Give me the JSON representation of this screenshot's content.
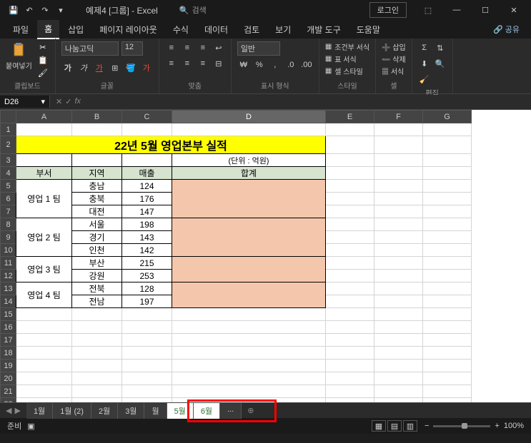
{
  "title": "예제4 [그룹] - Excel",
  "search_placeholder": "검색",
  "login_label": "로그인",
  "tabs": {
    "file": "파일",
    "home": "홈",
    "insert": "삽입",
    "layout": "페이지 레이아웃",
    "formula": "수식",
    "data": "데이터",
    "review": "검토",
    "view": "보기",
    "dev": "개발 도구",
    "help": "도움말"
  },
  "share_label": "공유",
  "ribbon": {
    "clipboard": {
      "label": "클립보드",
      "paste": "붙여넣기"
    },
    "font": {
      "label": "글꼴",
      "name": "나눔고딕",
      "size": "12",
      "bold": "가",
      "italic": "가",
      "underline": "가"
    },
    "align": {
      "label": "맞춤"
    },
    "number": {
      "label": "표시 형식",
      "format": "일반"
    },
    "styles": {
      "label": "스타일",
      "cond": "조건부 서식",
      "table": "표 서식",
      "cell": "셀 스타일"
    },
    "cells": {
      "label": "셀",
      "insert": "삽입",
      "delete": "삭제",
      "format": "서식"
    },
    "edit": {
      "label": "편집"
    }
  },
  "namebox": "D26",
  "chart_data": {
    "type": "table",
    "title": "22년 5월 영업본부 실적",
    "unit": "(단위 : 억원)",
    "columns": [
      "부서",
      "지역",
      "매출",
      "합계"
    ],
    "rows": [
      {
        "dept": "영업 1 팀",
        "region": "충남",
        "sales": 124
      },
      {
        "dept": "",
        "region": "충북",
        "sales": 176
      },
      {
        "dept": "",
        "region": "대전",
        "sales": 147
      },
      {
        "dept": "영업 2 팀",
        "region": "서울",
        "sales": 198
      },
      {
        "dept": "",
        "region": "경기",
        "sales": 143
      },
      {
        "dept": "",
        "region": "인천",
        "sales": 142
      },
      {
        "dept": "영업 3 팀",
        "region": "부산",
        "sales": 215
      },
      {
        "dept": "",
        "region": "강원",
        "sales": 253
      },
      {
        "dept": "영업 4 팀",
        "region": "전북",
        "sales": 128
      },
      {
        "dept": "",
        "region": "전남",
        "sales": 197
      }
    ]
  },
  "sheet_tabs": [
    "1월",
    "1월 (2)",
    "2월",
    "3월",
    "월",
    "5월",
    "6월",
    "..."
  ],
  "status": {
    "ready": "준비",
    "zoom": "100%"
  },
  "col_headers": [
    "A",
    "B",
    "C",
    "D",
    "E",
    "F",
    "G"
  ]
}
